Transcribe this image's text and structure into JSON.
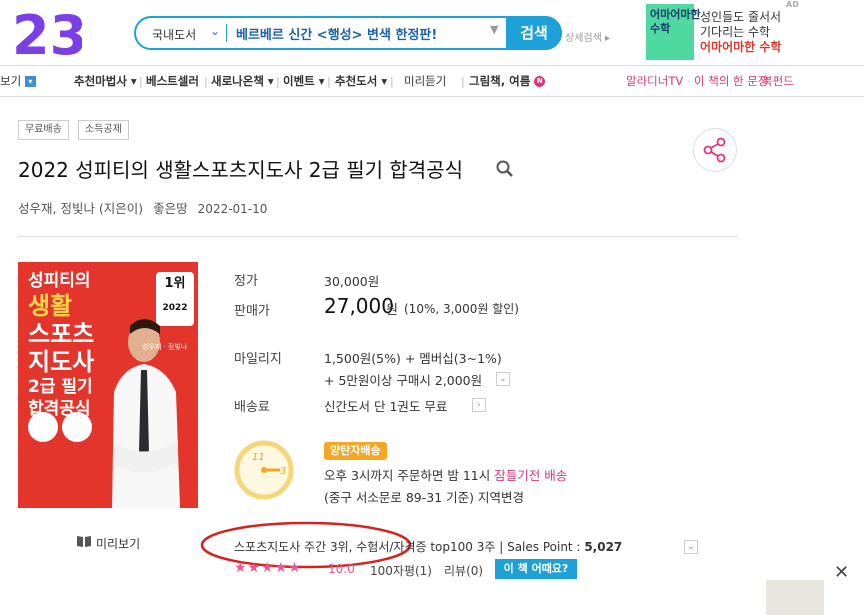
{
  "header": {
    "logo_text": "23",
    "search": {
      "category": "국내도서",
      "query": "베르베르 신간 <행성> 변색 한정판!",
      "button": "검색"
    },
    "advanced_search": "상세검색 ▸",
    "ad": {
      "label": "AD",
      "cover_text": "어마어마한 수학",
      "line1": "성인들도 줄서서",
      "line2": "기다리는 수학",
      "line3": "어마어마한 수학"
    }
  },
  "nav": {
    "items": [
      "보기",
      "추천마법사",
      "베스트셀러",
      "새로나온책",
      "이벤트",
      "추천도서",
      "미리듣기",
      "그림책, 여름"
    ],
    "new_badge": "N",
    "right": [
      "알라디너TV",
      "이 책의 한 문장",
      "북펀드"
    ]
  },
  "product": {
    "tags": [
      "무료배송",
      "소득공제"
    ],
    "title": "2022 성피티의 생활스포츠지도사 2급 필기 합격공식",
    "authors": "성우재,  정빛나 (지은이)",
    "publisher": "좋은땅",
    "date": "2022-01-10",
    "cover": {
      "title_lines": [
        "성피티의",
        "생활",
        "스포츠",
        "지도사",
        "2급 필기",
        "합격공식"
      ],
      "badge_top": "1위",
      "badge_year": "2022",
      "author_small": "성우재 · 정빛나"
    },
    "preview_label": "미리보기"
  },
  "pricing": {
    "list_label": "정가",
    "list_value": "30,000원",
    "sale_label": "판매가",
    "sale_value": "27,000",
    "sale_unit": "원",
    "sale_discount": "(10%, 3,000원 할인)",
    "mileage_label": "마일리지",
    "mileage_line1": "1,500원(5%) + 멤버십(3~1%)",
    "mileage_line2": "+ 5만원이상 구매시 2,000원",
    "shipping_label": "배송료",
    "shipping_value": "신간도서 단 1권도 무료",
    "delivery_badge": "양탄자배송",
    "delivery_line1_pre": "오후 3시까지 주문하면 밤 11시 ",
    "delivery_line1_hl": "잠들기전 배송",
    "delivery_line2": "(중구 서소문로 89-31 기준) 지역변경",
    "clock_11": "11",
    "clock_3": "3"
  },
  "rank": {
    "text": "스포츠지도사 주간 3위, 수험서/자격증 top100 3주  |  Sales Point : ",
    "sales_point": "5,027",
    "stars": "★★★★★",
    "score": "10.0",
    "reviews100": "100자평(1)",
    "reviews": "리뷰(0)",
    "howabout": "이 책 어때요?"
  },
  "colors": {
    "accent": "#1da1d8",
    "pink": "#d8377a",
    "cover_red": "#e4352c",
    "oval": "#d8201e"
  }
}
